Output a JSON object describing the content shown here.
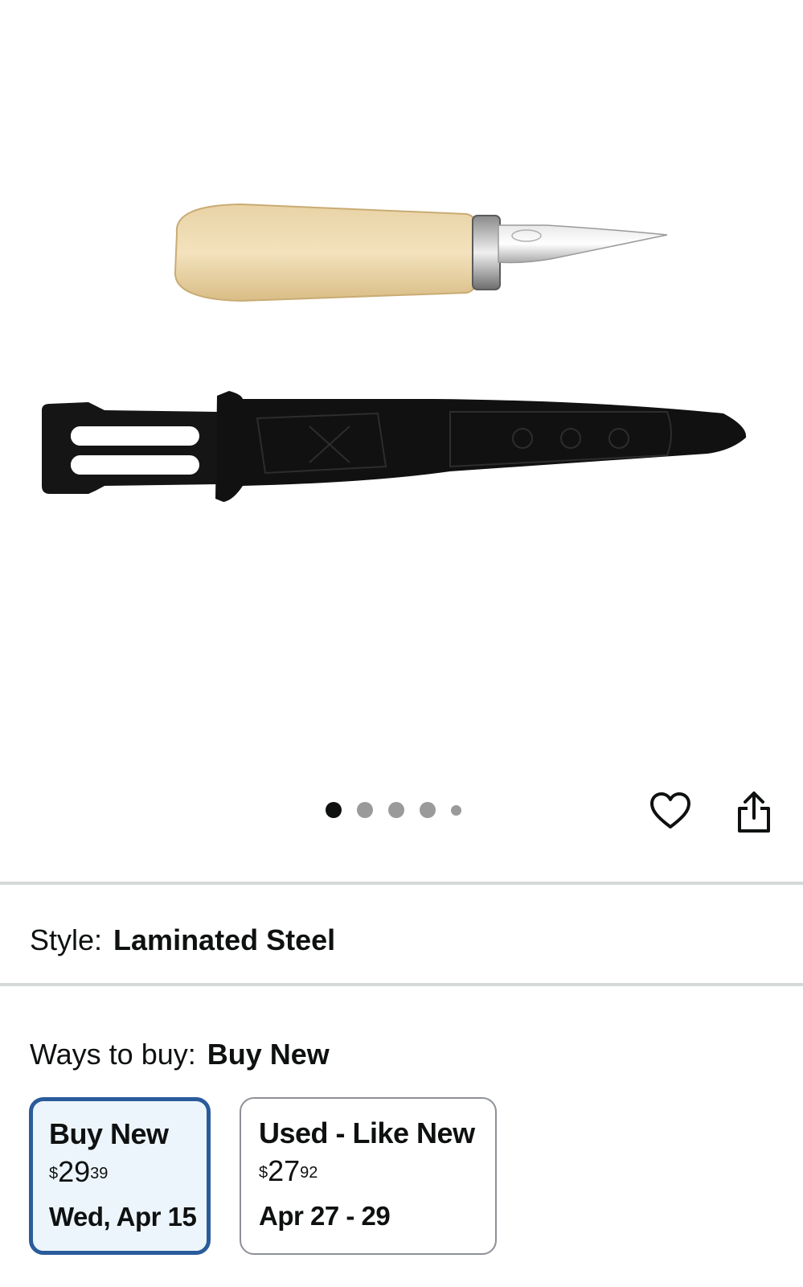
{
  "gallery": {
    "image_alt": "Wood carving knife with black sheath",
    "image_count": 5,
    "active_index": 0,
    "icons": {
      "favorite": "heart-icon",
      "share": "share-icon"
    }
  },
  "style": {
    "label": "Style:",
    "value": "Laminated Steel"
  },
  "ways_to_buy": {
    "label": "Ways to buy:",
    "selected": "Buy New",
    "options": [
      {
        "title": "Buy New",
        "currency": "$",
        "price_whole": "29",
        "price_fraction": "39",
        "delivery": "Wed, Apr 15",
        "selected": true
      },
      {
        "title": "Used - Like New",
        "currency": "$",
        "price_whole": "27",
        "price_fraction": "92",
        "delivery": "Apr 27 - 29",
        "selected": false
      }
    ]
  },
  "colors": {
    "selected_border": "#2a5b9b",
    "selected_bg": "#ecf5fb",
    "divider": "#d5d9d9",
    "text": "#0f1111"
  }
}
